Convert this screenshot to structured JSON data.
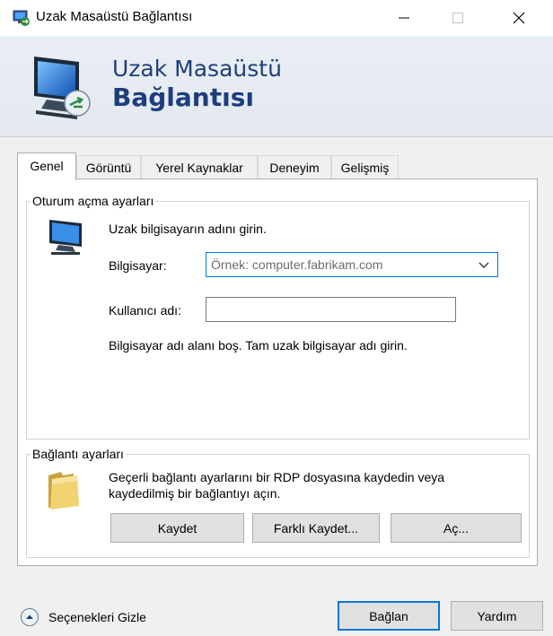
{
  "window": {
    "title": "Uzak Masaüstü Bağlantısı",
    "minimize_icon": "minimize-icon",
    "maximize_icon": "maximize-icon",
    "close_icon": "close-icon"
  },
  "banner": {
    "line1": "Uzak Masaüstü",
    "line2": "Bağlantısı"
  },
  "tabs": [
    {
      "label": "Genel",
      "active": true
    },
    {
      "label": "Görüntü",
      "active": false
    },
    {
      "label": "Yerel Kaynaklar",
      "active": false
    },
    {
      "label": "Deneyim",
      "active": false
    },
    {
      "label": "Gelişmiş",
      "active": false
    }
  ],
  "logon": {
    "group_title": "Oturum açma ayarları",
    "instruction": "Uzak bilgisayarın adını girin.",
    "computer_label": "Bilgisayar:",
    "computer_placeholder": "Örnek: computer.fabrikam.com",
    "username_label": "Kullanıcı adı:",
    "username_value": "",
    "warning": "Bilgisayar adı alanı boş. Tam uzak bilgisayar adı girin."
  },
  "connection": {
    "group_title": "Bağlantı ayarları",
    "description_line1": "Geçerli bağlantı ayarlarını bir RDP dosyasına kaydedin veya",
    "description_line2": "kaydedilmiş bir bağlantıyı açın.",
    "save_label": "Kaydet",
    "save_as_label": "Farklı Kaydet...",
    "open_label": "Aç..."
  },
  "footer": {
    "hide_options_label": "Seçenekleri Gizle",
    "connect_label": "Bağlan",
    "help_label": "Yardım"
  },
  "colors": {
    "banner_text": "#1d3e7d",
    "focus_border": "#0078d7",
    "dialog_bg": "#f0f0f0"
  }
}
